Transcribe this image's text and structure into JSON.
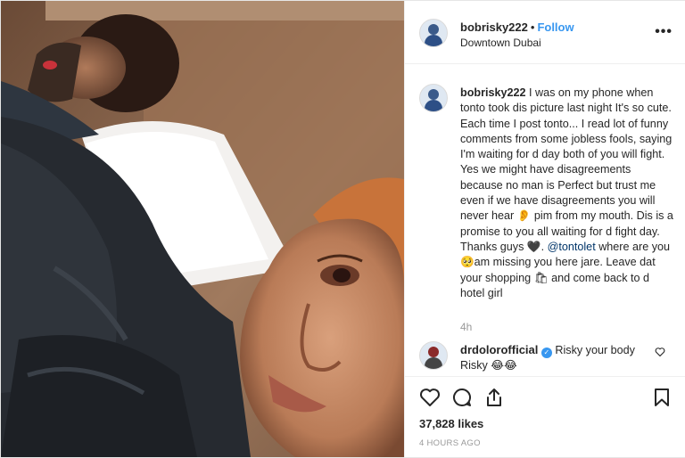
{
  "header": {
    "username": "bobrisky222",
    "separator": "•",
    "follow_label": "Follow",
    "location": "Downtown Dubai",
    "more_label": "•••"
  },
  "caption": {
    "username": "bobrisky222",
    "text_1": "I was on my phone when tonto took dis picture last night It's so cute. Each time I post tonto... I read lot of funny comments from some jobless fools, saying I'm waiting for d day both of you will fight. Yes we might have disagreements because no man is Perfect but trust me even if we have disagreements you will never hear 👂 pim from my mouth. Dis is a promise to you all waiting for d fight day. Thanks guys ",
    "heart": "🖤",
    "text_2": ". ",
    "mention": "@tontolet",
    "text_3": " where are you 🥺am missing you here jare. Leave dat your shopping 🛍 and come back to d hotel girl",
    "time_ago": "4h"
  },
  "comment": {
    "username": "drdolorofficial",
    "verified_mark": "✓",
    "text": "Risky your body Risky 😂😂"
  },
  "footer": {
    "likes": "37,828 likes",
    "posted": "4 HOURS AGO"
  }
}
